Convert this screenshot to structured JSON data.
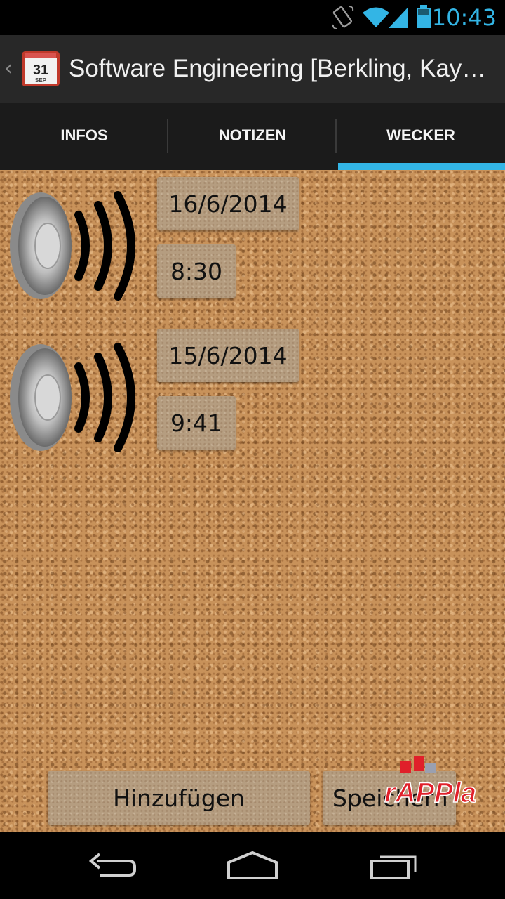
{
  "status_bar": {
    "time": "10:43",
    "accent_color": "#33b5e5",
    "icons": [
      "rotate-icon",
      "wifi-icon",
      "signal-icon",
      "battery-icon"
    ]
  },
  "action_bar": {
    "title": "Software Engineering [Berkling, Kay…",
    "app_icon": "calendar-icon",
    "app_icon_day": "31",
    "app_icon_month": "SEP"
  },
  "tabs": [
    {
      "label": "INFOS",
      "active": false
    },
    {
      "label": "NOTIZEN",
      "active": false
    },
    {
      "label": "WECKER",
      "active": true
    }
  ],
  "alarms": [
    {
      "date": "16/6/2014",
      "time": "8:30",
      "icon": "speaker-icon"
    },
    {
      "date": "15/6/2014",
      "time": "9:41",
      "icon": "speaker-icon"
    }
  ],
  "buttons": {
    "add_label": "Hinzufügen",
    "save_label": "Speichern"
  },
  "logo": {
    "text": "rAPPla",
    "brand_color": "#e0202a"
  },
  "nav_bar": {
    "icons": [
      "back-icon",
      "home-icon",
      "recent-apps-icon"
    ]
  }
}
